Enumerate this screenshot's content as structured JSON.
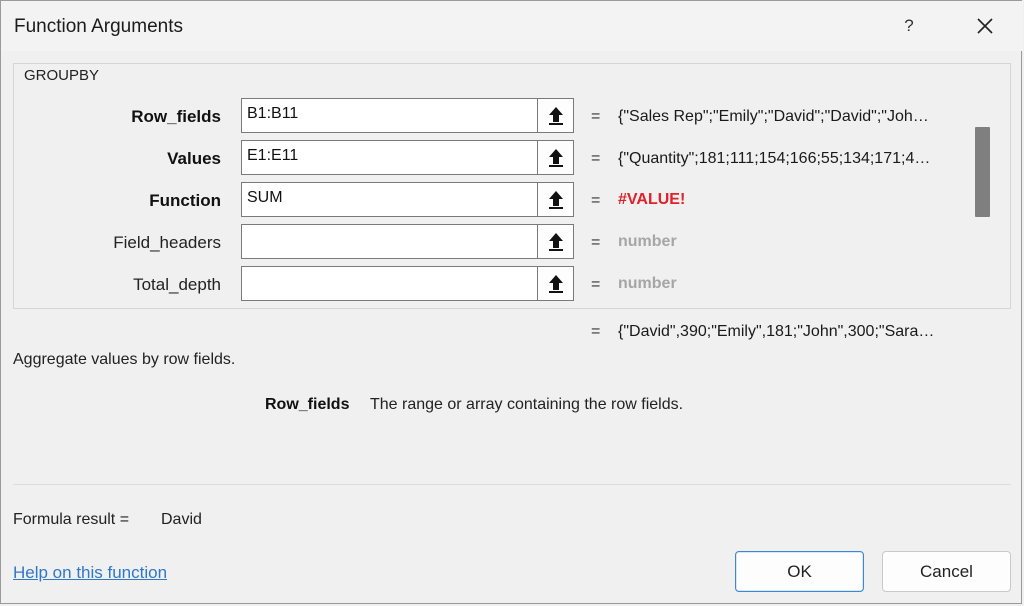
{
  "dialog": {
    "title": "Function Arguments",
    "help_symbol": "?",
    "close_icon": "close-icon"
  },
  "function_group": {
    "name": "GROUPBY",
    "arguments": [
      {
        "label": "Row_fields",
        "bold": true,
        "value": "B1:B11",
        "result": "{\"Sales Rep\";\"Emily\";\"David\";\"David\";\"Joh…",
        "result_style": "normal"
      },
      {
        "label": "Values",
        "bold": true,
        "value": "E1:E11",
        "result": "{\"Quantity\";181;111;154;166;55;134;171;4…",
        "result_style": "normal"
      },
      {
        "label": "Function",
        "bold": true,
        "value": "SUM",
        "result": "#VALUE!",
        "result_style": "error"
      },
      {
        "label": "Field_headers",
        "bold": false,
        "value": "",
        "result": "number",
        "result_style": "hint"
      },
      {
        "label": "Total_depth",
        "bold": false,
        "value": "",
        "result": "number",
        "result_style": "hint"
      }
    ],
    "equals": "="
  },
  "overall_result": "{\"David\",390;\"Emily\",181;\"John\",300;\"Sara…",
  "description": "Aggregate values by row fields.",
  "argument_help": {
    "name": "Row_fields",
    "text": "The range or array containing the row fields."
  },
  "formula_result": {
    "label": "Formula result =",
    "value": "David"
  },
  "footer": {
    "help_link": "Help on this function",
    "ok_label": "OK",
    "cancel_label": "Cancel"
  },
  "colors": {
    "error": "#e0202a",
    "hint": "#a6a6a6",
    "link": "#2f78c8",
    "ok_border": "#3d87d3"
  }
}
